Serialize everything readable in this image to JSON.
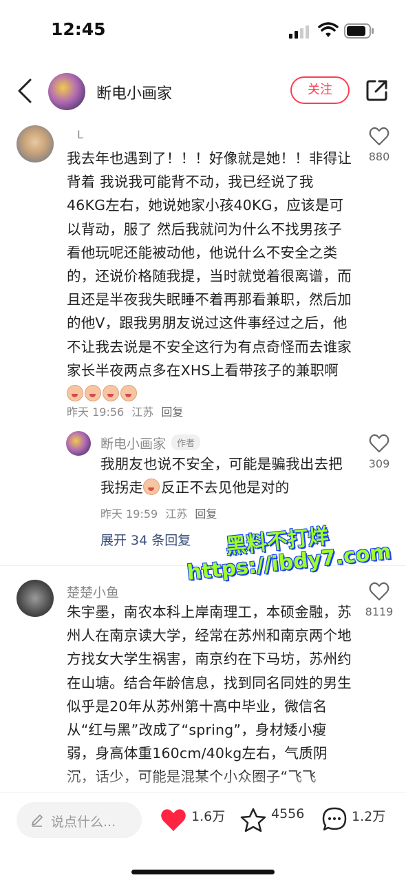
{
  "status_bar": {
    "time": "12:45"
  },
  "header": {
    "name": "断电小画家",
    "follow_label": "关注"
  },
  "comments": [
    {
      "name": "L",
      "text": "我去年也遇到了！！！好像就是她！！非得让背着 我说我可能背不动，我已经说了我46KG左右，她说她家小孩40KG，应该是可以背动，服了 然后我就问为什么不找男孩子看他玩呢还能被动他，他说什么不安全之类的，还说价格随我提，当时就觉着很离谱，而且还是半夜我失眠睡不着再那看兼职，然后加的他V，跟我男朋友说过这件事经过之后，他不让我去说是不安全这行为有点奇怪而去谁家家长半夜两点多在XHS上看带孩子的兼职啊",
      "time": "昨天 19:56",
      "location": "江苏",
      "reply_label": "回复",
      "likes": "880"
    },
    {
      "name": "断电小画家",
      "author_tag": "作者",
      "text_a": "我朋友也说不安全，可能是骗我出去把我拐走",
      "text_b": "反正不去见他是对的",
      "time": "昨天 19:59",
      "location": "江苏",
      "reply_label": "回复",
      "likes": "309"
    },
    {
      "name": "楚楚小鱼",
      "text": "朱宇墨，南农本科上岸南理工，本硕金融，苏州人在南京读大学，经常在苏州和南京两个地方找女大学生祸害，南京约在下马坊，苏州约在山塘。结合年龄信息，找到同名同姓的男生似乎是20年从苏州第十高中毕业，微信名从“红与黑”改成了“spring”，身材矮小瘦弱，身高体重160cm/40kg左右，气质阴沉，话少，可能是混某个小众圈子“飞飞子”，喜欢读飞的觉做一一希望通过",
      "likes": "8119"
    }
  ],
  "expand_label": "展开 34 条回复",
  "watermark": {
    "line1": "黑料不打烊",
    "line2": "https://ibdy7.com"
  },
  "bottom_bar": {
    "input_placeholder": "说点什么...",
    "likes": "1.6万",
    "favorites": "4556",
    "comments": "1.2万"
  },
  "colors": {
    "accent": "#ff3b4e",
    "link": "#3a4e7a",
    "like_red": "#ff2442"
  }
}
